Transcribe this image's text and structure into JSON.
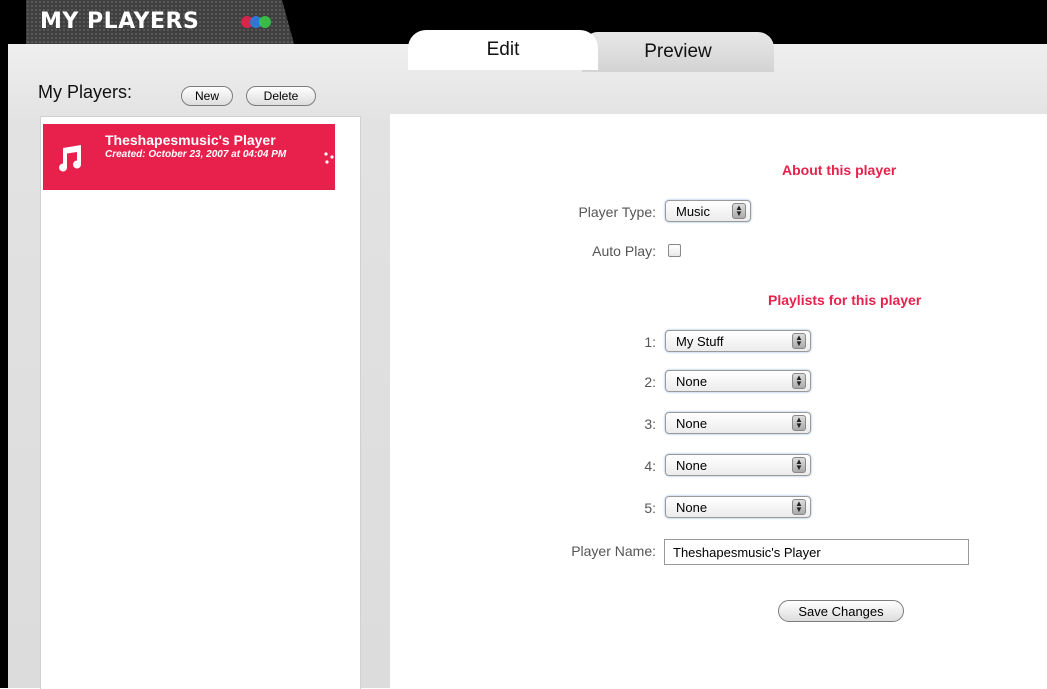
{
  "header": {
    "title": "MY PLAYERS",
    "logo_colors": [
      "#e8214c",
      "#2a7de1",
      "#37c84a"
    ]
  },
  "sidebar": {
    "label": "My Players:",
    "new_button": "New",
    "delete_button": "Delete",
    "players": [
      {
        "name": "Theshapesmusic's Player",
        "created": "Created: October 23, 2007 at 04:04 PM",
        "icon": "music-note-icon",
        "selected": true
      }
    ]
  },
  "tabs": [
    {
      "label": "Edit",
      "active": true
    },
    {
      "label": "Preview",
      "active": false
    }
  ],
  "form": {
    "about_heading": "About this player",
    "player_type_label": "Player Type:",
    "player_type_value": "Music",
    "auto_play_label": "Auto Play:",
    "auto_play_checked": false,
    "playlists_heading": "Playlists for this player",
    "playlists": [
      {
        "label": "1:",
        "value": "My Stuff"
      },
      {
        "label": "2:",
        "value": "None"
      },
      {
        "label": "3:",
        "value": "None"
      },
      {
        "label": "4:",
        "value": "None"
      },
      {
        "label": "5:",
        "value": "None"
      }
    ],
    "player_name_label": "Player Name:",
    "player_name_value": "Theshapesmusic's Player",
    "save_button": "Save Changes"
  },
  "colors": {
    "accent": "#e8214c",
    "header_bg": "#000000"
  }
}
